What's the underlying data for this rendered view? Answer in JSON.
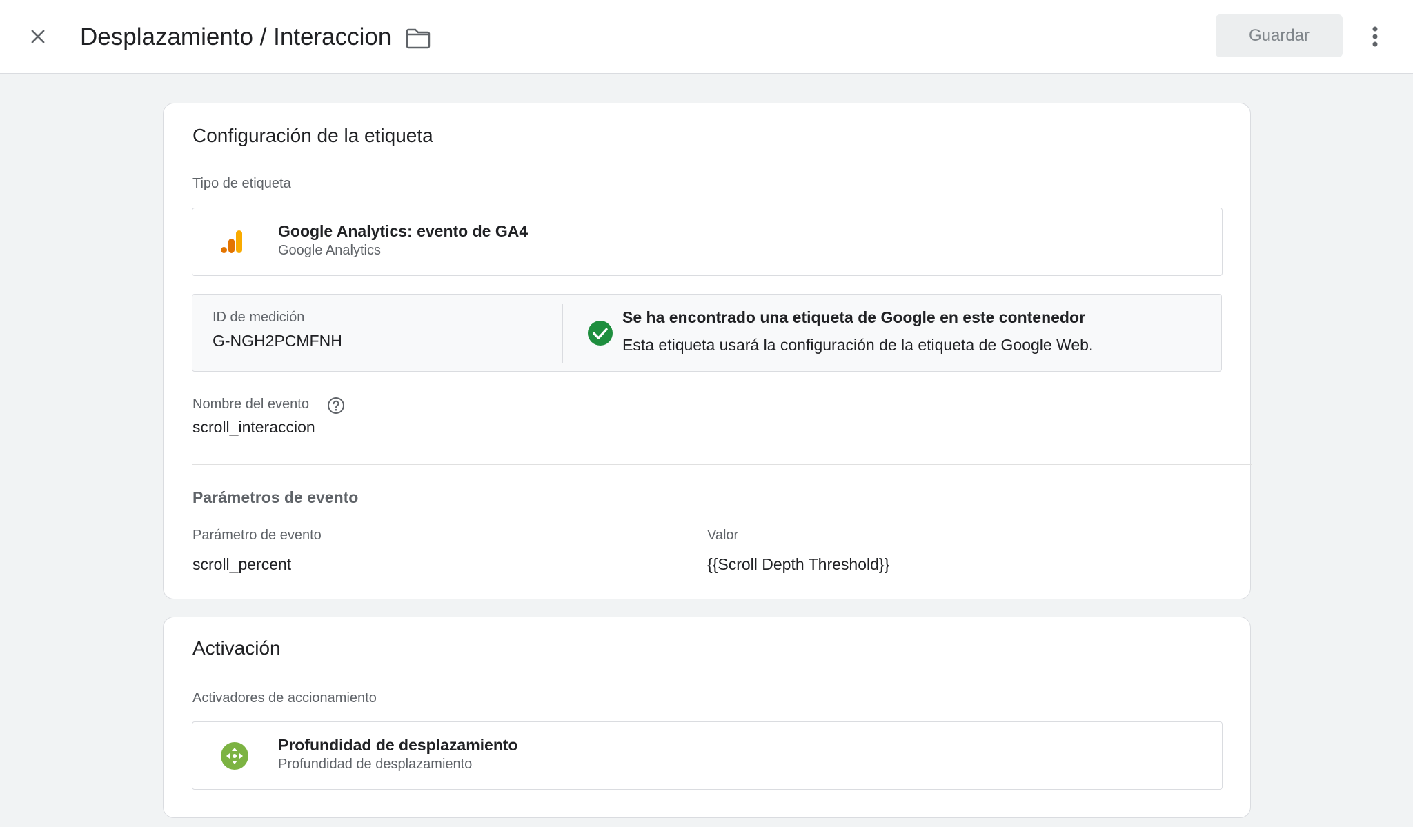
{
  "header": {
    "tag_name": "Desplazamiento / Interaccion",
    "save_label": "Guardar"
  },
  "tag_config": {
    "title": "Configuración de la etiqueta",
    "type_label": "Tipo de etiqueta",
    "type": {
      "name": "Google Analytics: evento de GA4",
      "provider": "Google Analytics"
    },
    "measurement": {
      "label": "ID de medición",
      "id": "G-NGH2PCMFNH",
      "status_title": "Se ha encontrado una etiqueta de Google en este contenedor",
      "status_text": "Esta etiqueta usará la configuración de la etiqueta de Google Web."
    },
    "event_name_label": "Nombre del evento",
    "event_name": "scroll_interaccion",
    "params_title": "Parámetros de evento",
    "params_headers": {
      "param": "Parámetro de evento",
      "value": "Valor"
    },
    "params": [
      {
        "param": "scroll_percent",
        "value": "{{Scroll Depth Threshold}}"
      }
    ]
  },
  "activation": {
    "title": "Activación",
    "triggers_label": "Activadores de accionamiento",
    "trigger": {
      "name": "Profundidad de desplazamiento",
      "type": "Profundidad de desplazamiento"
    }
  },
  "colors": {
    "ga_orange": "#f9ab00",
    "ga_dark_orange": "#e37400",
    "success_green": "#1e8e3e",
    "trigger_green": "#7cb342"
  },
  "icons": {
    "close": "close-icon",
    "folder": "folder-icon",
    "more": "more-vert-icon",
    "analytics": "google-analytics-icon",
    "check": "check-circle-icon",
    "help": "help-icon",
    "scroll": "scroll-depth-icon"
  }
}
